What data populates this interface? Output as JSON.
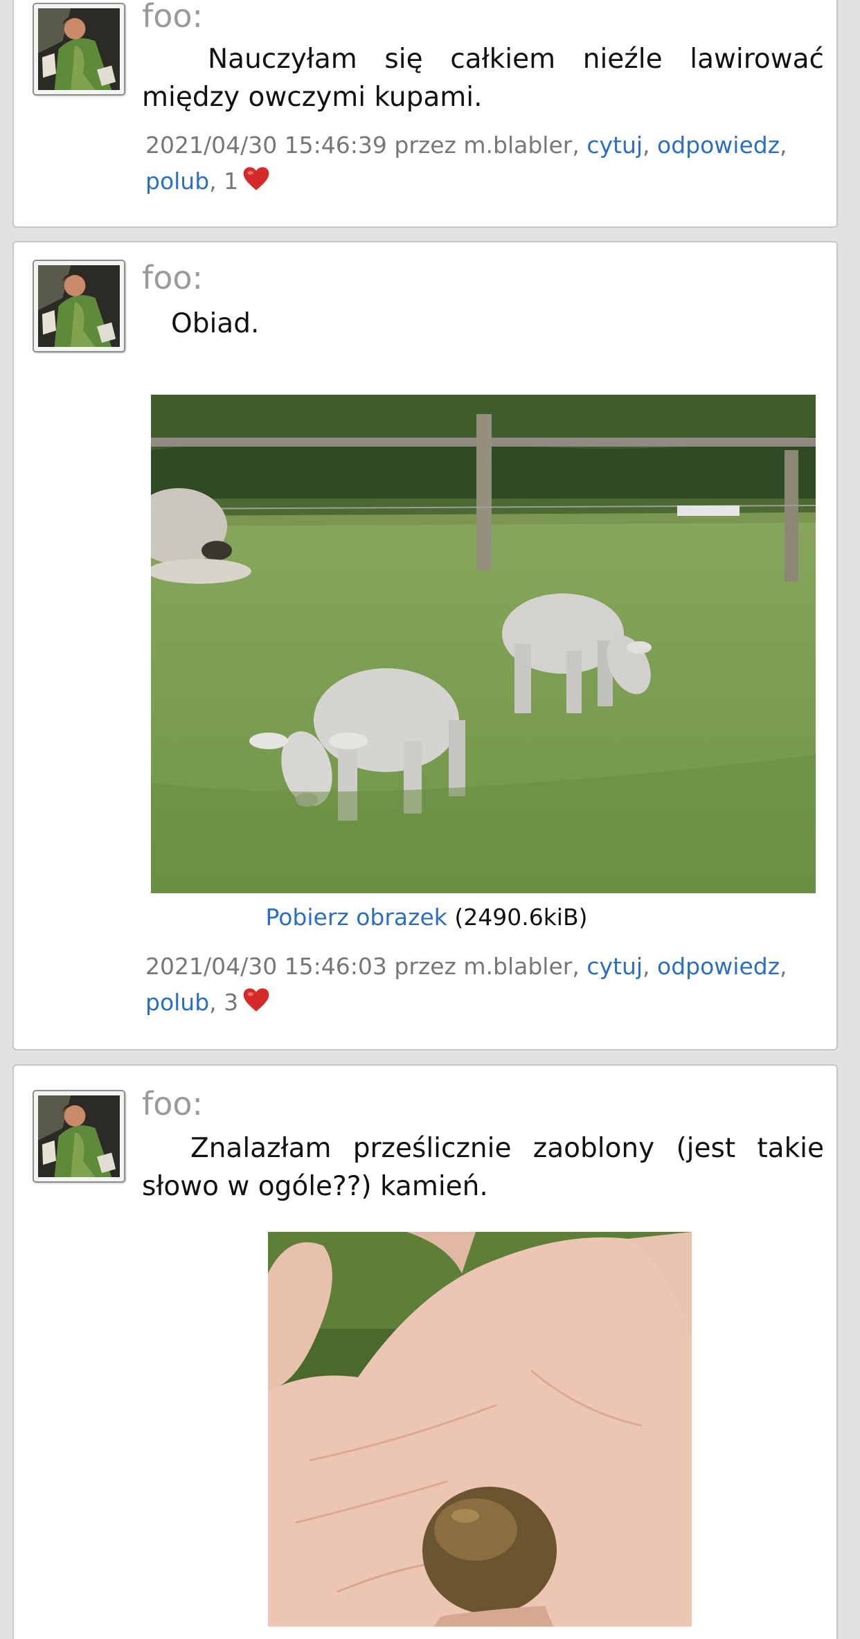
{
  "posts": [
    {
      "author": "foo:",
      "text": "Nauczyłam się całkiem nieźle lawirować między owczymi kupami.",
      "timestamp": "2021/04/30 15:46:39",
      "by_prefix": "przez",
      "user": "m.blabler",
      "quote_label": "cytuj",
      "reply_label": "odpowiedz",
      "like_label": "polub",
      "likes": "1",
      "heart_icon": "heart-icon"
    },
    {
      "author": "foo:",
      "text": "Obiad.",
      "image_download_label": "Pobierz obrazek",
      "image_size": "(2490.6kiB)",
      "timestamp": "2021/04/30 15:46:03",
      "by_prefix": "przez",
      "user": "m.blabler",
      "quote_label": "cytuj",
      "reply_label": "odpowiedz",
      "like_label": "polub",
      "likes": "3",
      "heart_icon": "heart-icon"
    },
    {
      "author": "foo:",
      "text": "Znalazłam prześlicznie zaoblony (jest takie słowo w ogóle??) kamień."
    }
  ],
  "colors": {
    "link": "#2a6fc4",
    "heart": "#d42a2a",
    "card_border": "#c6c6c6",
    "page_bg": "#e2e2e2"
  }
}
